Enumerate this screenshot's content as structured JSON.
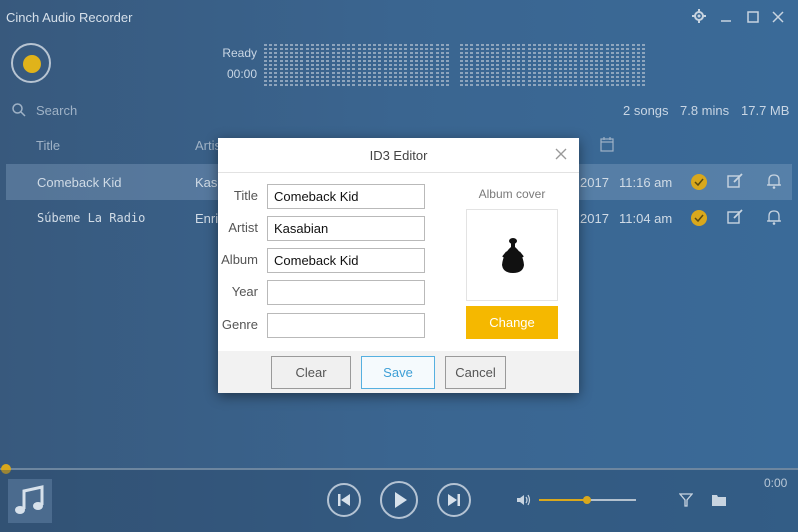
{
  "app": {
    "title": "Cinch Audio Recorder"
  },
  "recorder": {
    "status": "Ready",
    "time": "00:00"
  },
  "search": {
    "placeholder": "Search"
  },
  "summary": {
    "songs": "2 songs",
    "duration": "7.8 mins",
    "size": "17.7 MB"
  },
  "columns": {
    "title": "Title",
    "artist": "Artis"
  },
  "tracks": [
    {
      "title": "Comeback Kid",
      "artist": "Kas",
      "date": "2017",
      "time": "11:16 am"
    },
    {
      "title": "Súbeme La Radio",
      "artist": "Enri",
      "date": "2017",
      "time": "11:04 am"
    }
  ],
  "player": {
    "time": "0:00"
  },
  "dialog": {
    "title": "ID3 Editor",
    "fields": [
      {
        "label": "Title",
        "value": "Comeback Kid"
      },
      {
        "label": "Artist",
        "value": "Kasabian"
      },
      {
        "label": "Album",
        "value": "Comeback Kid"
      },
      {
        "label": "Year",
        "value": ""
      },
      {
        "label": "Genre",
        "value": ""
      }
    ],
    "cover_label": "Album cover",
    "change_label": "Change",
    "clear_label": "Clear",
    "save_label": "Save",
    "cancel_label": "Cancel"
  },
  "colors": {
    "accent": "#f5b800",
    "check": "#d9a81c",
    "background": "#3a6590"
  },
  "icons": [
    "gear-icon",
    "minimize-icon",
    "maximize-icon",
    "close-icon",
    "search-icon",
    "calendar-icon",
    "check-icon",
    "edit-icon",
    "bell-icon",
    "music-note-icon",
    "previous-icon",
    "play-icon",
    "next-icon",
    "volume-icon",
    "filter-icon",
    "folder-icon"
  ]
}
